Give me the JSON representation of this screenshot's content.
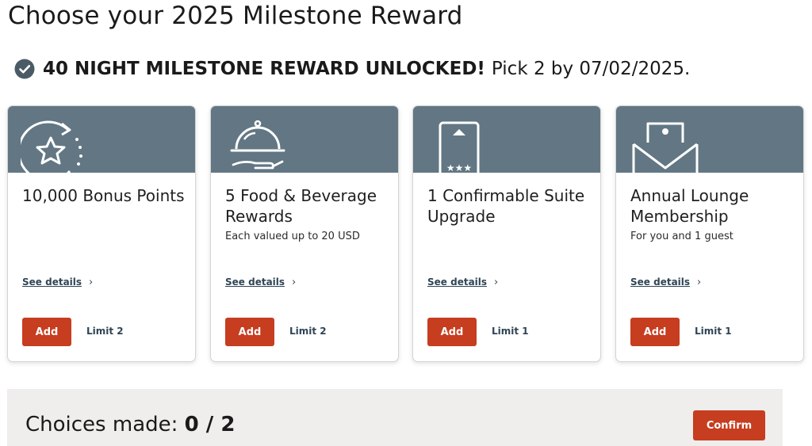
{
  "page": {
    "title": "Choose your 2025 Milestone Reward"
  },
  "banner": {
    "headline": "40 NIGHT MILESTONE REWARD UNLOCKED!",
    "detail": "Pick 2 by 07/02/2025."
  },
  "cards": [
    {
      "icon": "star-refresh-icon",
      "title": "10,000 Bonus Points",
      "subtitle": "",
      "details_label": "See details",
      "add_label": "Add",
      "limit": "Limit 2"
    },
    {
      "icon": "food-cloche-icon",
      "title": "5 Food & Beverage Rewards",
      "subtitle": "Each valued up to 20 USD",
      "details_label": "See details",
      "add_label": "Add",
      "limit": "Limit 2"
    },
    {
      "icon": "suite-door-icon",
      "title": "1 Confirmable Suite Upgrade",
      "subtitle": "",
      "details_label": "See details",
      "add_label": "Add",
      "limit": "Limit 1"
    },
    {
      "icon": "lounge-envelope-icon",
      "title": "Annual Lounge Membership",
      "subtitle": "For you and 1 guest",
      "details_label": "See details",
      "add_label": "Add",
      "limit": "Limit 1"
    }
  ],
  "footer": {
    "choices_label": "Choices made:",
    "choices_value": "0 / 2",
    "confirm_label": "Confirm"
  },
  "colors": {
    "card_header": "#627783",
    "accent": "#c63d1f",
    "link": "#2f4556",
    "footer_bg": "#efeeec"
  }
}
